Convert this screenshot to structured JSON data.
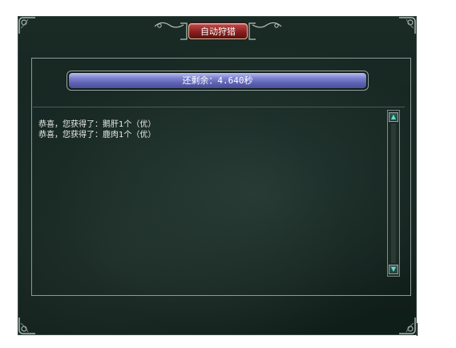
{
  "dialog": {
    "title": "自动狩猎",
    "progress": {
      "label": "还剩余：4.640秒",
      "fill_fraction": 1.0,
      "fill_color": "#5a5fb0"
    },
    "log": [
      "恭喜，您获得了：鹅肝1个（优）",
      "恭喜，您获得了：鹿肉1个（优）"
    ],
    "scrollbar": {
      "up_icon": "arrow-up-icon",
      "down_icon": "arrow-down-icon"
    },
    "colors": {
      "panel_bg": "#142420",
      "title_button": "#8a1e1e",
      "text": "#e8ece6"
    }
  }
}
